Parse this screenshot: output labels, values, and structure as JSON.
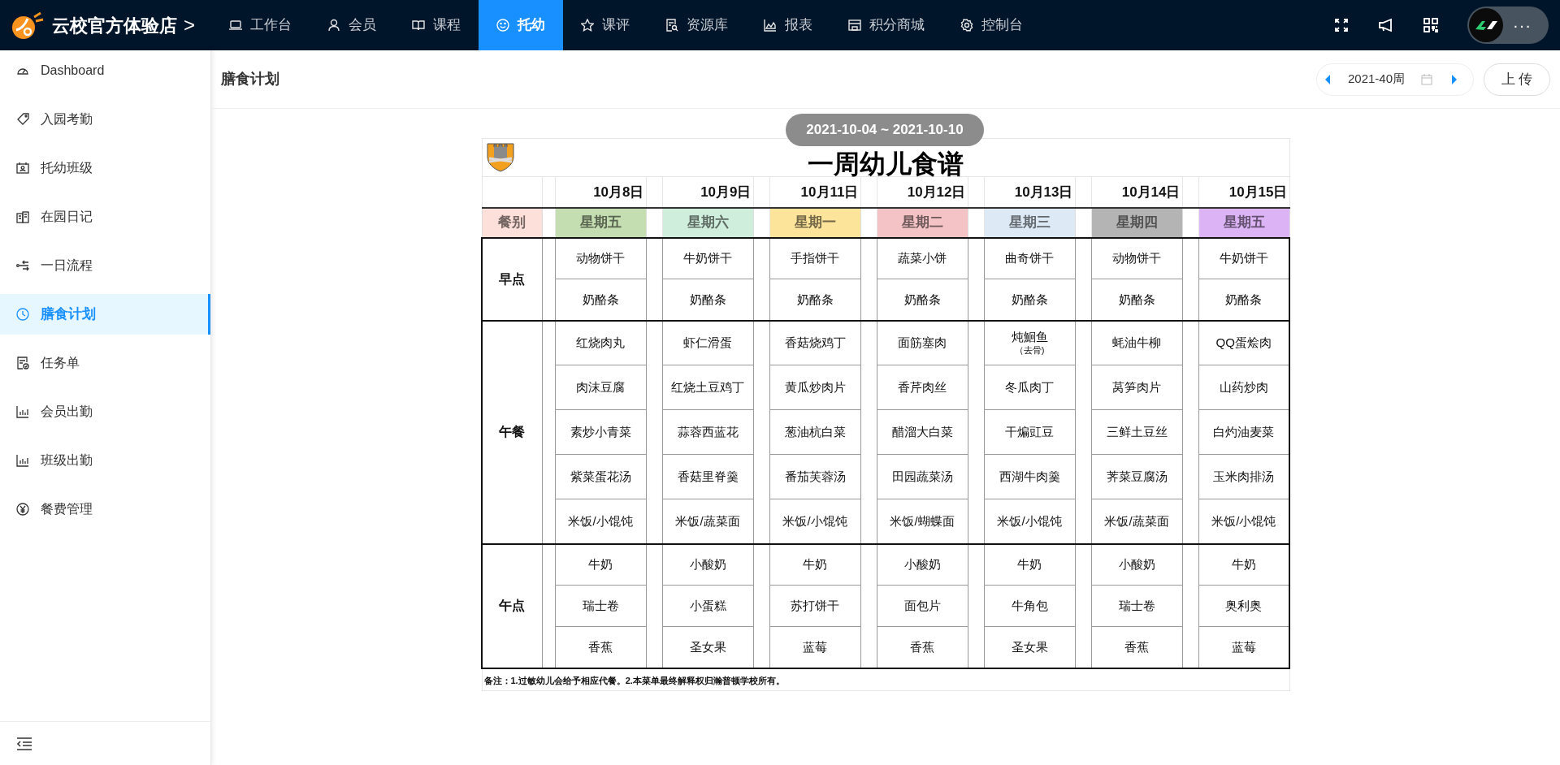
{
  "brand": {
    "name": "云校官方体验店",
    "chevron": ">"
  },
  "nav": [
    {
      "label": "工作台",
      "selected": false
    },
    {
      "label": "会员",
      "selected": false
    },
    {
      "label": "课程",
      "selected": false
    },
    {
      "label": "托幼",
      "selected": true
    },
    {
      "label": "课评",
      "selected": false
    },
    {
      "label": "资源库",
      "selected": false
    },
    {
      "label": "报表",
      "selected": false
    },
    {
      "label": "积分商城",
      "selected": false
    },
    {
      "label": "控制台",
      "selected": false
    }
  ],
  "user_menu": {
    "more": "···"
  },
  "sidebar": {
    "items": [
      {
        "label": "Dashboard",
        "selected": false
      },
      {
        "label": "入园考勤",
        "selected": false
      },
      {
        "label": "托幼班级",
        "selected": false
      },
      {
        "label": "在园日记",
        "selected": false
      },
      {
        "label": "一日流程",
        "selected": false
      },
      {
        "label": "膳食计划",
        "selected": true
      },
      {
        "label": "任务单",
        "selected": false
      },
      {
        "label": "会员出勤",
        "selected": false
      },
      {
        "label": "班级出勤",
        "selected": false
      },
      {
        "label": "餐费管理",
        "selected": false
      }
    ]
  },
  "page": {
    "title": "膳食计划",
    "week": "2021-40周",
    "upload_button": "上 传"
  },
  "menu": {
    "range": "2021-10-04 ~ 2021-10-10",
    "title": "一周幼儿食谱",
    "category_header": {
      "label": "餐别",
      "color": "#fde0d9"
    },
    "days": [
      {
        "date": "10月8日",
        "weekday": "星期五",
        "color": "#c5deb1"
      },
      {
        "date": "10月9日",
        "weekday": "星期六",
        "color": "#cfeedb"
      },
      {
        "date": "10月11日",
        "weekday": "星期一",
        "color": "#fde49b"
      },
      {
        "date": "10月12日",
        "weekday": "星期二",
        "color": "#f4c3c6"
      },
      {
        "date": "10月13日",
        "weekday": "星期三",
        "color": "#dde9f5"
      },
      {
        "date": "10月14日",
        "weekday": "星期四",
        "color": "#b4b4b4"
      },
      {
        "date": "10月15日",
        "weekday": "星期五",
        "color": "#dcb4f6"
      }
    ],
    "meals": [
      {
        "name": "早点",
        "rows": [
          [
            "动物饼干",
            "牛奶饼干",
            "手指饼干",
            "蔬菜小饼",
            "曲奇饼干",
            "动物饼干",
            "牛奶饼干"
          ],
          [
            "奶酪条",
            "奶酪条",
            "奶酪条",
            "奶酪条",
            "奶酪条",
            "奶酪条",
            "奶酪条"
          ]
        ]
      },
      {
        "name": "午餐",
        "rows": [
          [
            "红烧肉丸",
            "虾仁滑蛋",
            "香菇烧鸡丁",
            "面筋塞肉",
            {
              "text": "炖鮰鱼",
              "note": "（去骨)"
            },
            "蚝油牛柳",
            "QQ蛋烩肉"
          ],
          [
            "肉沫豆腐",
            "红烧土豆鸡丁",
            "黄瓜炒肉片",
            "香芹肉丝",
            "冬瓜肉丁",
            "莴笋肉片",
            "山药炒肉"
          ],
          [
            "素炒小青菜",
            "蒜蓉西蓝花",
            "葱油杭白菜",
            "醋溜大白菜",
            "干煸豇豆",
            "三鲜土豆丝",
            "白灼油麦菜"
          ],
          [
            "紫菜蛋花汤",
            "香菇里脊羹",
            "番茄芙蓉汤",
            "田园蔬菜汤",
            "西湖牛肉羹",
            "荠菜豆腐汤",
            "玉米肉排汤"
          ],
          [
            "米饭/小馄饨",
            "米饭/蔬菜面",
            "米饭/小馄饨",
            "米饭/蝴蝶面",
            "米饭/小馄饨",
            "米饭/蔬菜面",
            "米饭/小馄饨"
          ]
        ]
      },
      {
        "name": "午点",
        "rows": [
          [
            "牛奶",
            "小酸奶",
            "牛奶",
            "小酸奶",
            "牛奶",
            "小酸奶",
            "牛奶"
          ],
          [
            "瑞士卷",
            "小蛋糕",
            "苏打饼干",
            "面包片",
            "牛角包",
            "瑞士卷",
            "奥利奥"
          ],
          [
            "香蕉",
            "圣女果",
            "蓝莓",
            "香蕉",
            "圣女果",
            "香蕉",
            "蓝莓"
          ]
        ]
      }
    ],
    "note": "备注：1.过敏幼儿会给予相应代餐。2.本菜单最终解释权归瀚普顿学校所有。"
  }
}
